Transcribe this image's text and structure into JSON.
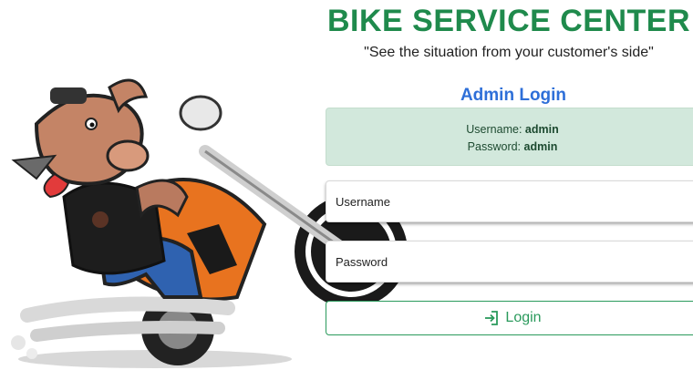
{
  "header": {
    "title": "BIKE SERVICE CENTER",
    "tagline": "\"See the situation from your customer's side\""
  },
  "login": {
    "heading": "Admin Login",
    "credentials": {
      "username_label": "Username:",
      "username_value": "admin",
      "password_label": "Password:",
      "password_value": "admin"
    },
    "username_placeholder": "Username",
    "password_placeholder": "Password",
    "button_label": "Login",
    "button_icon": "login-icon"
  },
  "colors": {
    "title_green": "#1f8a4c",
    "heading_blue": "#2e6fd8",
    "alert_bg": "#d2e8dc",
    "button_green": "#2a9a5c"
  }
}
